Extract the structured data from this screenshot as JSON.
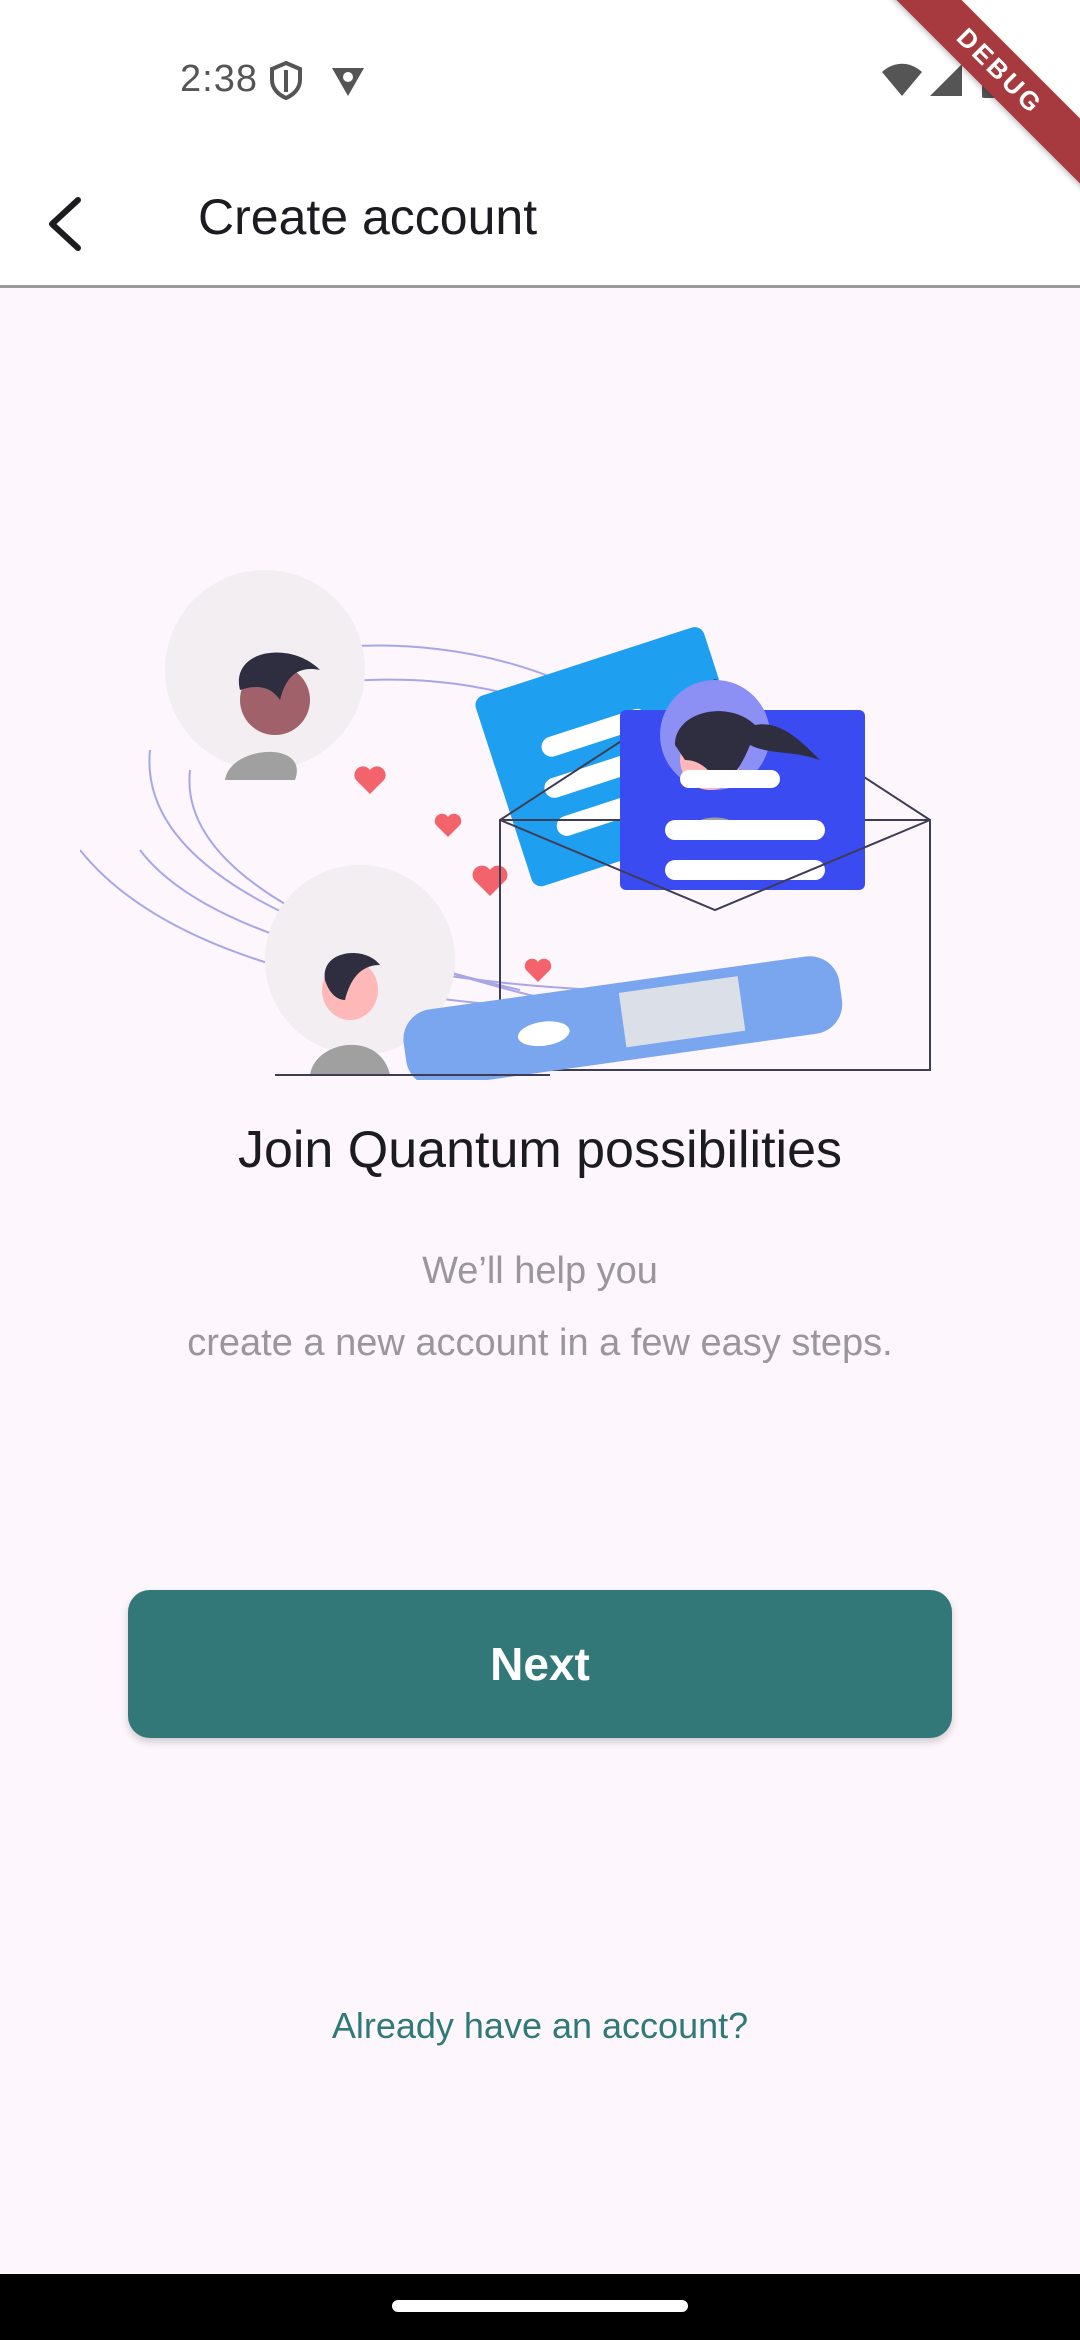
{
  "status_bar": {
    "time": "2:38",
    "icons": [
      "shield-icon",
      "vpn-icon",
      "wifi-icon",
      "signal-icon",
      "battery-icon"
    ]
  },
  "debug_banner": {
    "label": "DEBUG"
  },
  "app_bar": {
    "title": "Create account",
    "back_icon": "back-arrow-icon"
  },
  "main": {
    "illustration": "envelope-with-profiles-illustration",
    "headline": "Join Quantum possibilities",
    "subtitle_line1": "We’ll help you",
    "subtitle_line2": "create a new account in a few easy steps.",
    "next_label": "Next",
    "login_link": "Already have an account?"
  },
  "colors": {
    "primary": "#327878",
    "link": "#2f7a78",
    "background": "#fdf6fc",
    "debug": "#a63a3f"
  }
}
